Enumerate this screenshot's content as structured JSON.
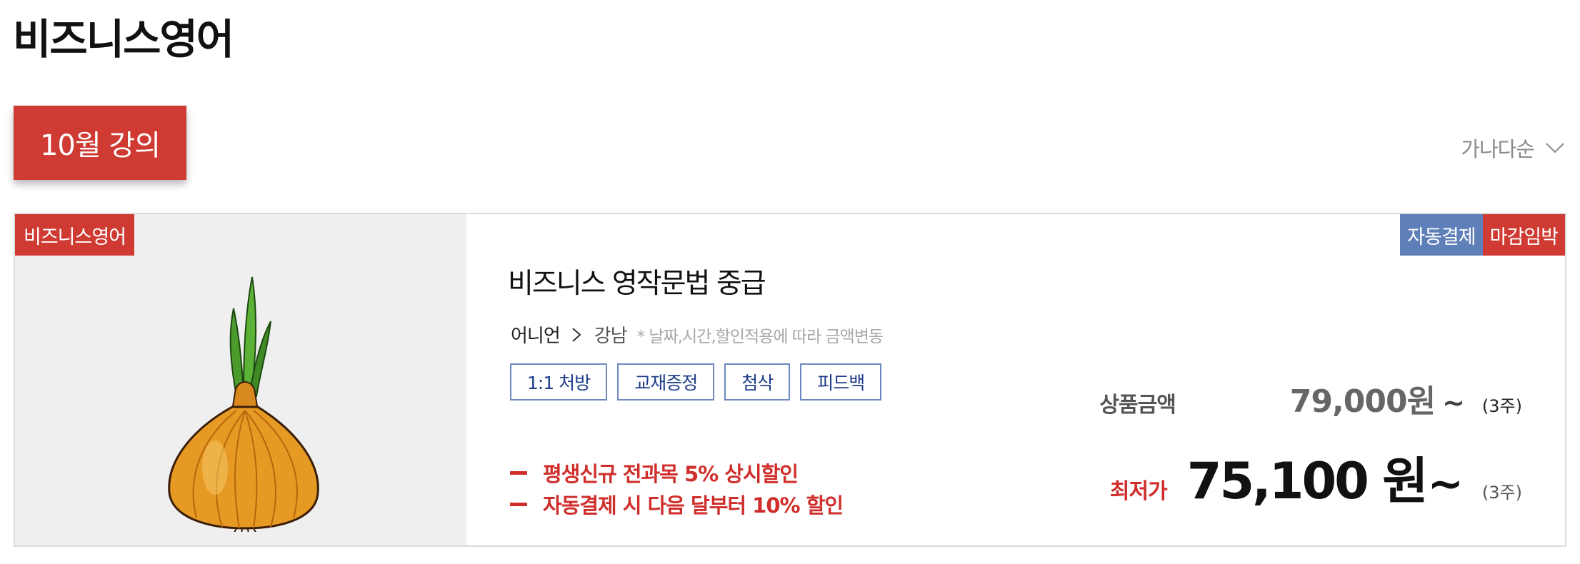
{
  "page": {
    "title": "비즈니스영어"
  },
  "month_tab": {
    "label": "10월 강의"
  },
  "sort": {
    "label": "가나다순"
  },
  "course": {
    "category": "비즈니스영어",
    "flags": {
      "auto_pay": "자동결제",
      "closing_soon": "마감임박"
    },
    "title": "비즈니스 영작문법 중급",
    "teacher": "어니언",
    "branch": "강남",
    "note": "* 날짜,시간,할인적용에 따라 금액변동",
    "tags": [
      "1:1 처방",
      "교재증정",
      "첨삭",
      "피드백"
    ],
    "promos": [
      "평생신규 전과목 5% 상시할인",
      "자동결제 시 다음 달부터 10% 할인"
    ],
    "list_price": {
      "label": "상품금액",
      "amount": "79,000원",
      "tilde": "~",
      "period": "(3주)"
    },
    "best_price": {
      "label": "최저가",
      "amount": "75,100 원",
      "tilde": "~",
      "period": "(3주)"
    }
  },
  "colors": {
    "accent_red": "#cf3a32",
    "auto_pay_blue": "#5f7fb9",
    "tag_border": "#6d88bf"
  }
}
